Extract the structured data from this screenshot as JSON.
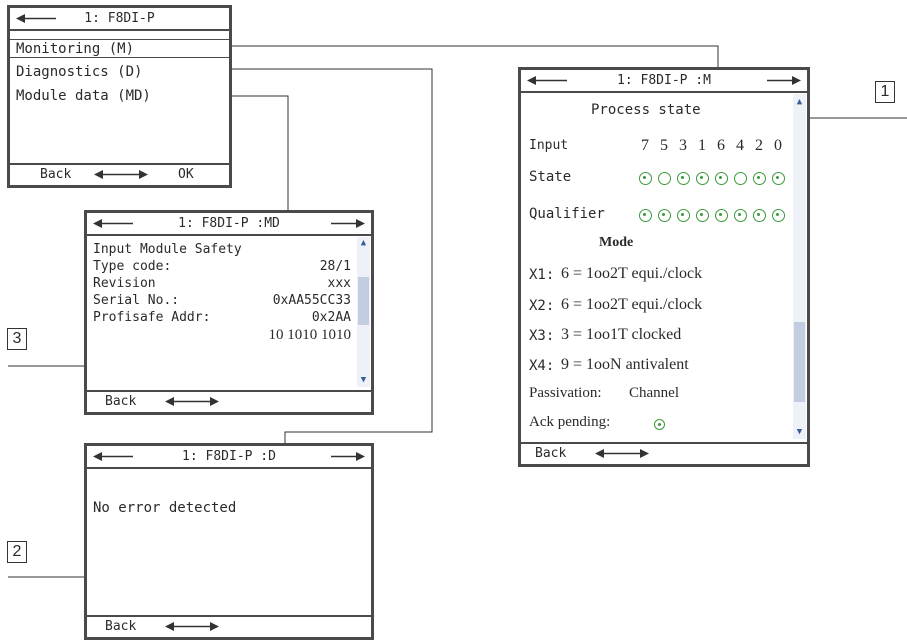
{
  "main_screen": {
    "title": "1: F8DI-P",
    "menu": [
      {
        "label": "Monitoring (M)"
      },
      {
        "label": "Diagnostics (D)"
      },
      {
        "label": "Module data (MD)"
      }
    ],
    "back_label": "Back",
    "ok_label": "OK"
  },
  "md_screen": {
    "title": "1: F8DI-P :MD",
    "heading": "Input Module Safety",
    "rows": [
      {
        "label": "Type code:",
        "value": "28/1"
      },
      {
        "label": "Revision",
        "value": "xxx"
      },
      {
        "label": "Serial No.:",
        "value": "0xAA55CC33"
      },
      {
        "label": "Profisafe Addr:",
        "value": "0x2AA"
      }
    ],
    "binary": "10 1010 1010",
    "back_label": "Back"
  },
  "d_screen": {
    "title": "1: F8DI-P :D",
    "message": "No error detected",
    "back_label": "Back"
  },
  "m_screen": {
    "title": "1: F8DI-P :M",
    "heading": "Process state",
    "input_label": "Input",
    "inputs": [
      "7",
      "5",
      "3",
      "1",
      "6",
      "4",
      "2",
      "0"
    ],
    "state_label": "State",
    "state_leds": [
      true,
      false,
      true,
      true,
      true,
      false,
      true,
      true
    ],
    "qualifier_label": "Qualifier",
    "qualifier_leds": [
      true,
      true,
      true,
      true,
      true,
      true,
      true,
      true
    ],
    "mode_heading": "Mode",
    "modes": [
      {
        "ch": "X1:",
        "text": "6 = 1oo2T equi./clock"
      },
      {
        "ch": "X2:",
        "text": "6 = 1oo2T equi./clock"
      },
      {
        "ch": "X3:",
        "text": "3 = 1oo1T clocked"
      },
      {
        "ch": "X4:",
        "text": "9 = 1ooN antivalent"
      }
    ],
    "passivation_label": "Passivation:",
    "passivation_value": "Channel",
    "ack_label": "Ack pending:",
    "back_label": "Back"
  },
  "callouts": {
    "one": "1",
    "two": "2",
    "three": "3"
  },
  "colors": {
    "frame": "#4a4a4a",
    "scroll": "#c2cde2",
    "led": "#3a9a3a",
    "callout_line": "#333333"
  }
}
